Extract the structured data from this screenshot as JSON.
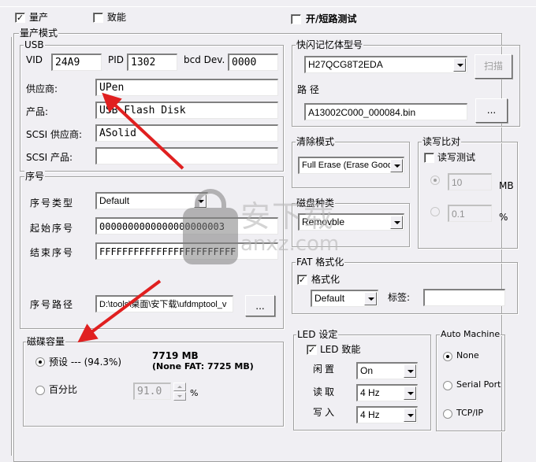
{
  "top": {
    "mass_production": {
      "label": "量产",
      "checked": true
    },
    "enable": {
      "label": "致能",
      "checked": false
    },
    "open_short_test": {
      "label": "开/短路测试",
      "checked": false
    }
  },
  "mp_mode": {
    "title": "量产模式",
    "usb": {
      "title": "USB",
      "vid_label": "VID",
      "vid": "24A9",
      "pid_label": "PID",
      "pid": "1302",
      "bcd_label": "bcd Dev.",
      "bcd": "0000",
      "vendor_label": "供应商:",
      "vendor": "UPen",
      "product_label": "产品:",
      "product": "USB Flash Disk",
      "scsi_vendor_label": "SCSI 供应商:",
      "scsi_vendor": "ASolid",
      "scsi_product_label": "SCSI 产品:",
      "scsi_product": ""
    },
    "serial": {
      "title": "序号",
      "type_label": "序号类型",
      "type": "Default",
      "start_label": "起始序号",
      "start": "0000000000000000000003",
      "end_label": "结束序号",
      "end": "FFFFFFFFFFFFFFFFFFFFFFFF",
      "path_label": "序号路径",
      "path": "D:\\tools\\桌面\\安下载\\ufdmptool_v",
      "browse": "..."
    },
    "capacity": {
      "title": "磁碟容量",
      "preset_label": "预设 --- (94.3%)",
      "preset_selected": true,
      "size": "7719  MB",
      "none_fat": "(None FAT: 7725 MB)",
      "percent_label": "百分比",
      "percent_selected": false,
      "percent_value": "91.0",
      "percent_unit": "%"
    }
  },
  "flash": {
    "title": "快闪记忆体型号",
    "model": "H27QCG8T2EDA",
    "scan": "扫描",
    "path_label": "路 径",
    "path": "A13002C000_000084.bin",
    "browse": "..."
  },
  "erase": {
    "title": "清除模式",
    "mode": "Full Erase (Erase Good)"
  },
  "disk_type": {
    "title": "磁盘种类",
    "type": "Removble"
  },
  "rw_compare": {
    "title": "读写比对",
    "test_label": "读写测试",
    "test_checked": false,
    "mb_value": "10",
    "mb_unit": "MB",
    "mb_selected": true,
    "pct_value": "0.1",
    "pct_unit": "%",
    "pct_selected": false
  },
  "fat": {
    "title": "FAT 格式化",
    "format_label": "格式化",
    "format_checked": true,
    "type": "Default",
    "tag_label": "标签:",
    "tag": ""
  },
  "led": {
    "title": "LED 设定",
    "enable_label": "LED 致能",
    "enable_checked": true,
    "idle_label": "闲置",
    "idle": "On",
    "read_label": "读取",
    "read": "4 Hz",
    "write_label": "写入",
    "write": "4 Hz"
  },
  "auto_machine": {
    "title": "Auto Machine",
    "options": [
      {
        "label": "None",
        "selected": true
      },
      {
        "label": "Serial Port",
        "selected": false
      },
      {
        "label": "TCP/IP",
        "selected": false
      }
    ]
  },
  "watermark": {
    "text": "安下载",
    "url": "anxz.com"
  },
  "colors": {
    "background": "#f0eff3",
    "arrow": "#e02020"
  }
}
